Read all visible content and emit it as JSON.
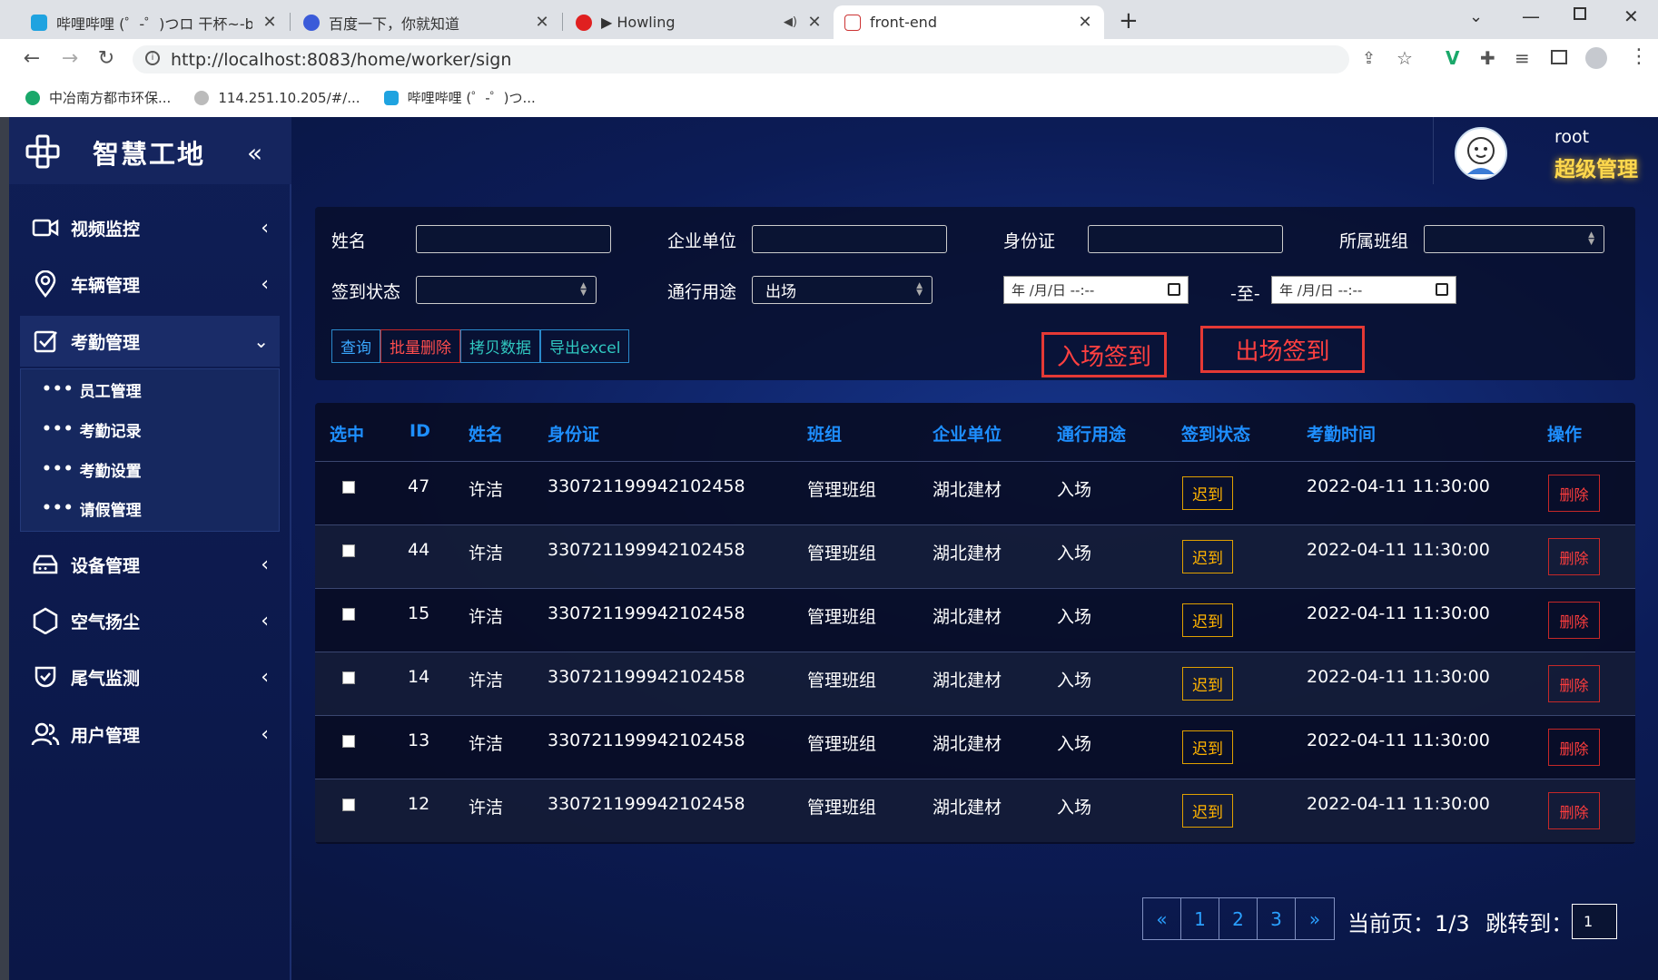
{
  "browser": {
    "tabs": [
      {
        "title": "哔哩哔哩 (゜-゜)つロ 干杯~-bilil",
        "icon": "bilibili-icon"
      },
      {
        "title": "百度一下，你就知道",
        "icon": "baidu-icon"
      },
      {
        "title": "▶ Howling",
        "icon": "netease-music-icon"
      },
      {
        "title": "front-end",
        "icon": "page-icon"
      }
    ],
    "url": "http://localhost:8083/home/worker/sign",
    "bookmarks": [
      "中冶南方都市环保...",
      "114.251.10.205/#/...",
      "哔哩哔哩 (゜-゜)つ..."
    ]
  },
  "sidebar": {
    "brand": "智慧工地",
    "collapse": "«",
    "menus": [
      {
        "label": "视频监控",
        "icon": "video-camera-icon"
      },
      {
        "label": "车辆管理",
        "icon": "location-pin-icon"
      },
      {
        "label": "考勤管理",
        "icon": "checkbox-icon"
      },
      {
        "label": "设备管理",
        "icon": "device-icon"
      },
      {
        "label": "空气扬尘",
        "icon": "hexagon-icon"
      },
      {
        "label": "尾气监测",
        "icon": "shield-check-icon"
      },
      {
        "label": "用户管理",
        "icon": "users-icon"
      }
    ],
    "submenu": [
      "员工管理",
      "考勤记录",
      "考勤设置",
      "请假管理"
    ]
  },
  "user": {
    "name": "root",
    "role": "超级管理"
  },
  "search": {
    "name_label": "姓名",
    "company_label": "企业单位",
    "idcard_label": "身份证",
    "team_label": "所属班组",
    "status_label": "签到状态",
    "purpose_label": "通行用途",
    "purpose_value": "出场",
    "date_placeholder": "年 /月/日 --:--",
    "date_sep": "-至-",
    "buttons": {
      "query": "查询",
      "batch_delete": "批量删除",
      "copy": "拷贝数据",
      "export": "导出excel"
    },
    "checkin_in": "入场签到",
    "checkin_out": "出场签到"
  },
  "table": {
    "headers": [
      "选中",
      "ID",
      "姓名",
      "身份证",
      "班组",
      "企业单位",
      "通行用途",
      "签到状态",
      "考勤时间",
      "操作"
    ],
    "rows": [
      {
        "id": "47",
        "name": "许洁",
        "idcard": "330721199942102458",
        "team": "管理班组",
        "company": "湖北建材",
        "purpose": "入场",
        "status": "迟到",
        "time": "2022-04-11 11:30:00",
        "op": "删除"
      },
      {
        "id": "44",
        "name": "许洁",
        "idcard": "330721199942102458",
        "team": "管理班组",
        "company": "湖北建材",
        "purpose": "入场",
        "status": "迟到",
        "time": "2022-04-11 11:30:00",
        "op": "删除"
      },
      {
        "id": "15",
        "name": "许洁",
        "idcard": "330721199942102458",
        "team": "管理班组",
        "company": "湖北建材",
        "purpose": "入场",
        "status": "迟到",
        "time": "2022-04-11 11:30:00",
        "op": "删除"
      },
      {
        "id": "14",
        "name": "许洁",
        "idcard": "330721199942102458",
        "team": "管理班组",
        "company": "湖北建材",
        "purpose": "入场",
        "status": "迟到",
        "time": "2022-04-11 11:30:00",
        "op": "删除"
      },
      {
        "id": "13",
        "name": "许洁",
        "idcard": "330721199942102458",
        "team": "管理班组",
        "company": "湖北建材",
        "purpose": "入场",
        "status": "迟到",
        "time": "2022-04-11 11:30:00",
        "op": "删除"
      },
      {
        "id": "12",
        "name": "许洁",
        "idcard": "330721199942102458",
        "team": "管理班组",
        "company": "湖北建材",
        "purpose": "入场",
        "status": "迟到",
        "time": "2022-04-11 11:30:00",
        "op": "删除"
      }
    ]
  },
  "pagination": {
    "prev": "«",
    "pages": [
      "1",
      "2",
      "3"
    ],
    "next": "»",
    "current_label": "当前页：",
    "current": "1/3",
    "jump_label": "跳转到：",
    "jump_value": "1"
  },
  "colors": {
    "accent": "#1e8fff",
    "danger": "#ff3d3d",
    "warning": "#ffb300",
    "role": "#ffd84d"
  }
}
